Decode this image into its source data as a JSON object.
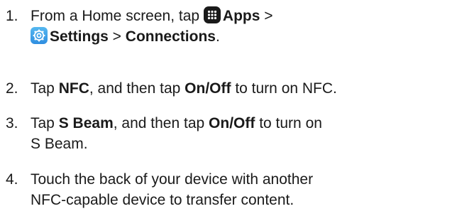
{
  "steps": [
    {
      "number": "1.",
      "line1": {
        "text_a": "From a Home screen, tap ",
        "icon_apps": "apps-icon",
        "bold_apps": "Apps",
        "sep": " >"
      },
      "line2": {
        "icon_settings": "settings-icon",
        "bold_settings": "Settings",
        "sep": " > ",
        "bold_connections": "Connections",
        "end": "."
      }
    },
    {
      "number": "2.",
      "text_a": "Tap ",
      "bold_a": "NFC",
      "text_b": ", and then tap ",
      "bold_b": "On/Off",
      "text_c": " to turn on NFC."
    },
    {
      "number": "3.",
      "text_a": "Tap ",
      "bold_a": "S Beam",
      "text_b": ", and then tap ",
      "bold_b": "On/Off",
      "text_c": " to turn on",
      "line2": "S Beam."
    },
    {
      "number": "4.",
      "line1": "Touch the back of your device with another",
      "line2": "NFC-capable device to transfer content."
    }
  ],
  "colors": {
    "text": "#1a1a1a",
    "apps_icon_bg": "#1a1a1a",
    "settings_icon_bg": "#2f8ee0"
  }
}
